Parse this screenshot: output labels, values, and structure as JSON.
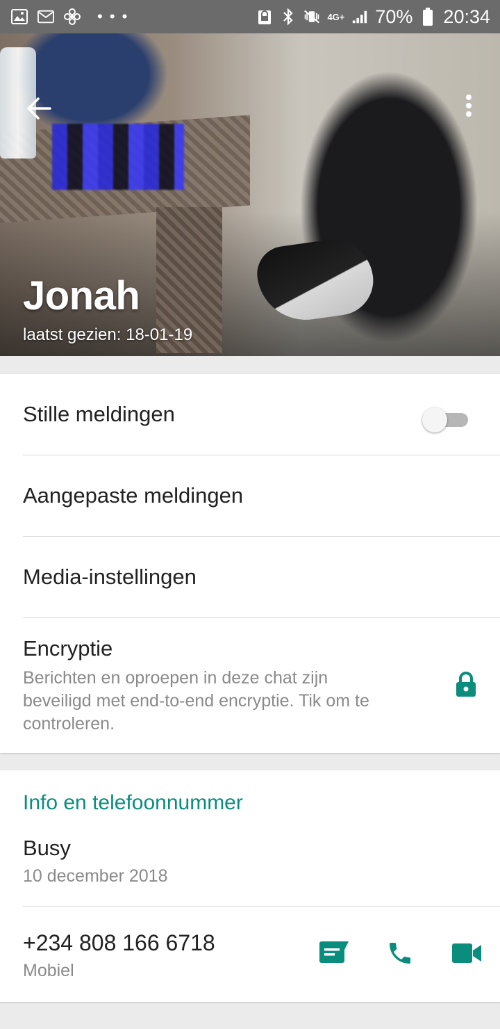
{
  "status_bar": {
    "left_icons": [
      "image-icon",
      "mail-icon",
      "fan-icon",
      "more-dots-icon"
    ],
    "network": "4G+",
    "battery_percent": "70%",
    "time": "20:34"
  },
  "header": {
    "contact_name": "Jonah",
    "last_seen": "laatst gezien: 18-01-19"
  },
  "settings": {
    "mute_label": "Stille meldingen",
    "mute_on": false,
    "custom_notifications_label": "Aangepaste meldingen",
    "media_settings_label": "Media-instellingen",
    "encryption_label": "Encryptie",
    "encryption_description": "Berichten en oproepen in deze chat zijn beveiligd met end-to-end encryptie. Tik om te controleren."
  },
  "info": {
    "section_title": "Info en telefoonnummer",
    "about_text": "Busy",
    "about_date": "10 december 2018",
    "phone_number": "+234 808 166 6718",
    "phone_type": "Mobiel"
  },
  "colors": {
    "accent": "#0a8d7d",
    "status_bar": "#6b6b6b",
    "secondary_text": "#8a8a8a"
  }
}
